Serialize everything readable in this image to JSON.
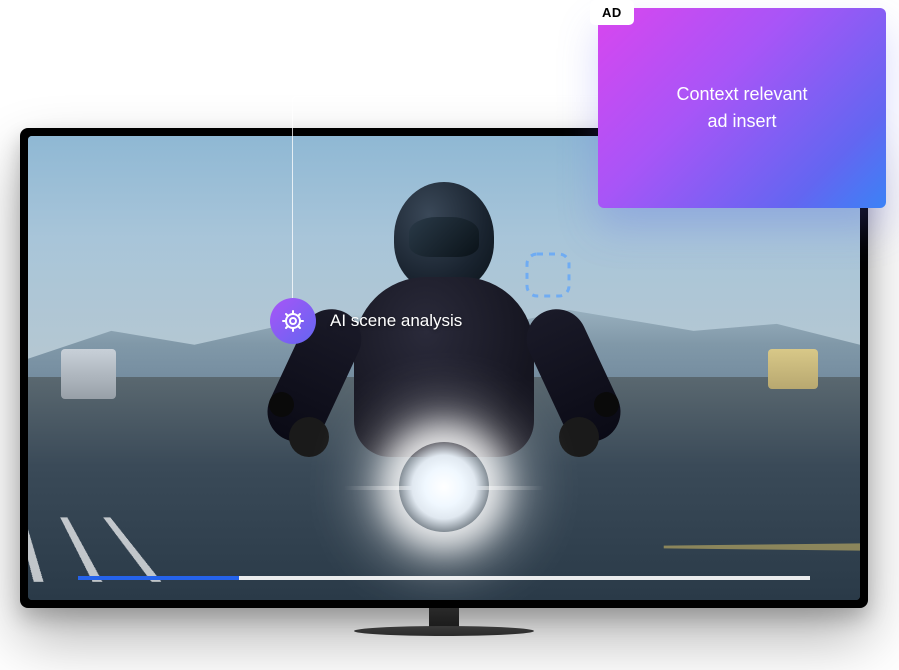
{
  "analysis": {
    "label": "AI scene analysis",
    "icon": "brain-circuit-icon"
  },
  "ad": {
    "tag": "AD",
    "line1": "Context relevant",
    "line2": "ad insert"
  },
  "progress": {
    "percent": 22
  },
  "colors": {
    "accent_purple": "#a855f7",
    "accent_blue": "#6366f1",
    "progress_blue": "#2563eb"
  }
}
